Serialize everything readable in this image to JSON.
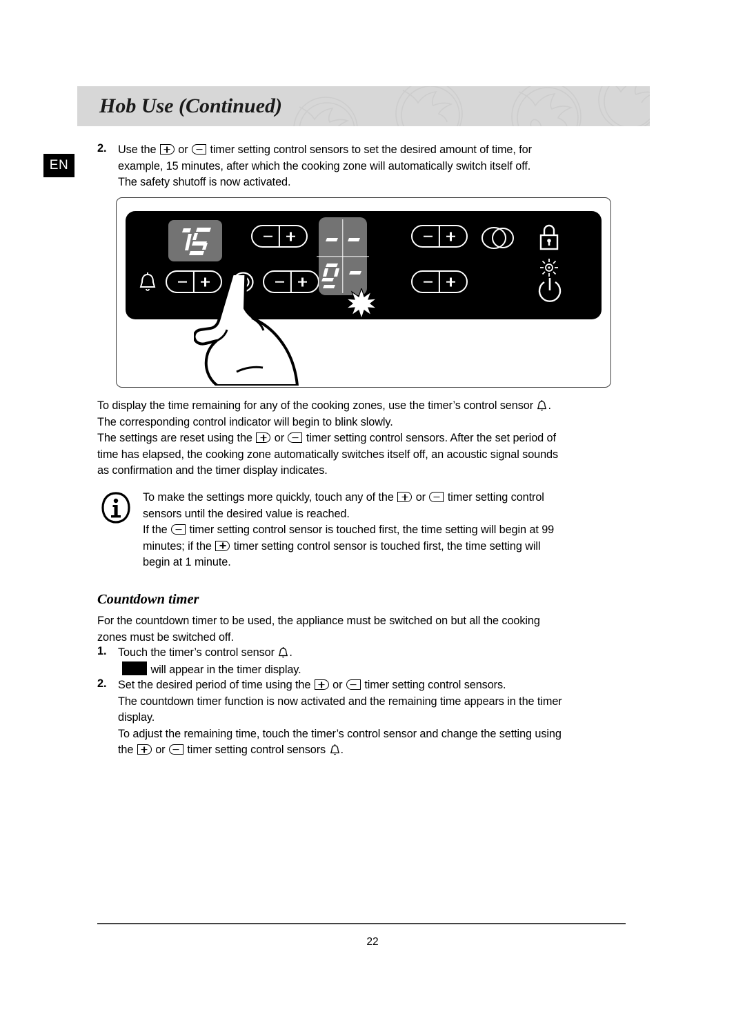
{
  "language_badge": "EN",
  "header": {
    "title": "Hob Use (Continued)",
    "band_color": "#d7d7d7",
    "watermark": "tomato-outline-pattern"
  },
  "step_2": {
    "marker": "2.",
    "line1_a": "Use the",
    "line1_b": "or",
    "line1_c": "timer setting control sensors to set the desired amount of time, for",
    "line2": "example, 15 minutes, after which the cooking zone will automatically switch itself off.",
    "line3": "The safety shutoff is now activated."
  },
  "illustration": {
    "name": "hob-control-panel-diagram",
    "panel_color": "#000000",
    "display_color": "#737373",
    "timer_display_value": "15",
    "zone_display": {
      "top_left": "-",
      "top_right": "-",
      "bottom_left": "0",
      "bottom_right": "-",
      "bottom_left_dot": "-"
    },
    "icons": [
      "bell-icon",
      "single-zone-icon",
      "dual-zone-icon",
      "lock-icon",
      "indicator-light-icon",
      "power-icon",
      "flash-starburst-icon",
      "pointing-hand-icon"
    ],
    "rockers": [
      "timer-rocker",
      "zone-rocker-rear-left",
      "zone-rocker-front-left",
      "zone-rocker-rear-right",
      "zone-rocker-front-right"
    ]
  },
  "para_1": {
    "line1_a": "To display the time remaining for any of the cooking zones, use the timer’s control sensor",
    "line1_b": ".",
    "line2": "The corresponding control indicator will begin to blink slowly."
  },
  "para_2": {
    "line1_a": "The settings are reset using the",
    "line1_b": "or",
    "line1_c": "timer setting control sensors. After the set period of",
    "line2": "time has elapsed, the cooking zone automatically switches itself off, an acoustic signal sounds",
    "line3": "as confirmation and the timer display indicates."
  },
  "info_note": {
    "icon": "info-i-icon",
    "p1_a": "To make the settings more quickly, touch any of the",
    "p1_b": "or",
    "p1_c": "timer setting control",
    "p1_line2": "sensors until the desired value is reached.",
    "p2_a": "If the",
    "p2_b": "timer setting control sensor is touched first, the time setting will begin at 99",
    "p2_line2_a": "minutes; if the",
    "p2_line2_b": "timer setting control sensor is touched first, the time setting will",
    "p2_line3": "begin at 1 minute."
  },
  "countdown_section": {
    "heading": "Countdown timer",
    "intro_line1": "For the countdown timer to be used, the appliance must be switched on but all the cooking",
    "intro_line2": "zones must be switched off.",
    "step1": {
      "marker": "1.",
      "text_a": "Touch the timer’s control sensor",
      "text_b": ".",
      "sub_text": "will appear in the timer display."
    },
    "step2": {
      "marker": "2.",
      "line1_a": "Set the desired period of time using the",
      "line1_b": "or",
      "line1_c": "timer setting control sensors.",
      "line2": "The countdown timer function is now activated and the remaining time appears in the timer",
      "line3": "display.",
      "line4": "To adjust the remaining time, touch the timer’s control sensor and change the setting using",
      "line5_a": "the",
      "line5_b": "or",
      "line5_c": "timer setting control sensors",
      "line5_d": "."
    }
  },
  "footer": {
    "page_number": "22"
  }
}
